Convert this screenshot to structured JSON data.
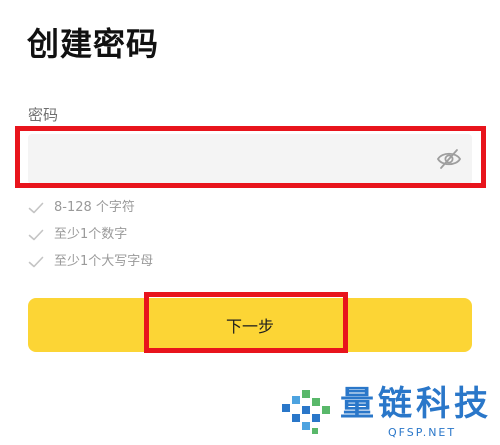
{
  "page": {
    "title": "创建密码"
  },
  "password": {
    "label": "密码",
    "value": "",
    "placeholder": "",
    "visibility_icon": "eye-off-icon"
  },
  "requirements": [
    {
      "text": "8-128 个字符",
      "icon": "check-icon"
    },
    {
      "text": "至少1个数字",
      "icon": "check-icon"
    },
    {
      "text": "至少1个大写字母",
      "icon": "check-icon"
    }
  ],
  "actions": {
    "next_label": "下一步"
  },
  "watermark": {
    "name": "量链科技",
    "url": "QFSP.NET"
  },
  "colors": {
    "accent": "#fcd535",
    "highlight": "#e8141c",
    "watermark": "#2a77c9",
    "check": "#c4c4c4"
  }
}
